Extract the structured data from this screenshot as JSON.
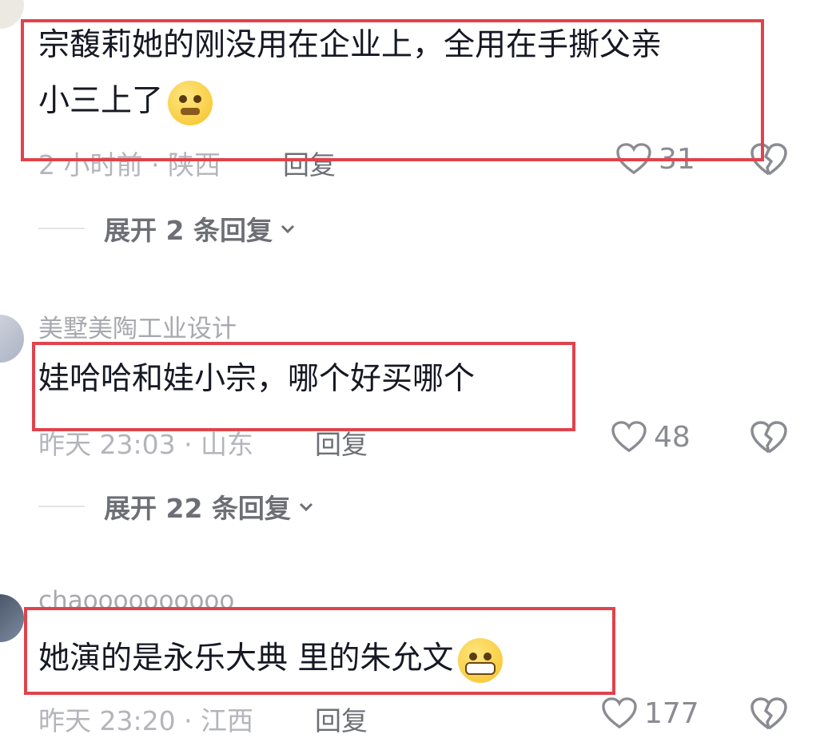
{
  "comments": [
    {
      "username": "",
      "text_line1": "宗馥莉她的刚没用在企业上，全用在手撕父亲",
      "text_line2": "小三上了",
      "emoji": "worried-face",
      "time_location": "2 小时前 · 陕西",
      "reply_label": "回复",
      "likes": "31",
      "expand_label": "展开 2 条回复"
    },
    {
      "username": "美墅美陶工业设计",
      "text_line1": "娃哈哈和娃小宗，哪个好买哪个",
      "time_location": "昨天 23:03 · 山东",
      "reply_label": "回复",
      "likes": "48",
      "expand_label": "展开 22 条回复"
    },
    {
      "username": "chaoooooooooo",
      "text_line1": "她演的是永乐大典 里的朱允文",
      "emoji": "grinning-face",
      "time_location": "昨天 23:20 · 江西",
      "reply_label": "回复",
      "likes": "177"
    }
  ],
  "colors": {
    "highlight_border": "#e0434b",
    "muted_text": "#a7a9ae",
    "body_text": "#161823"
  }
}
